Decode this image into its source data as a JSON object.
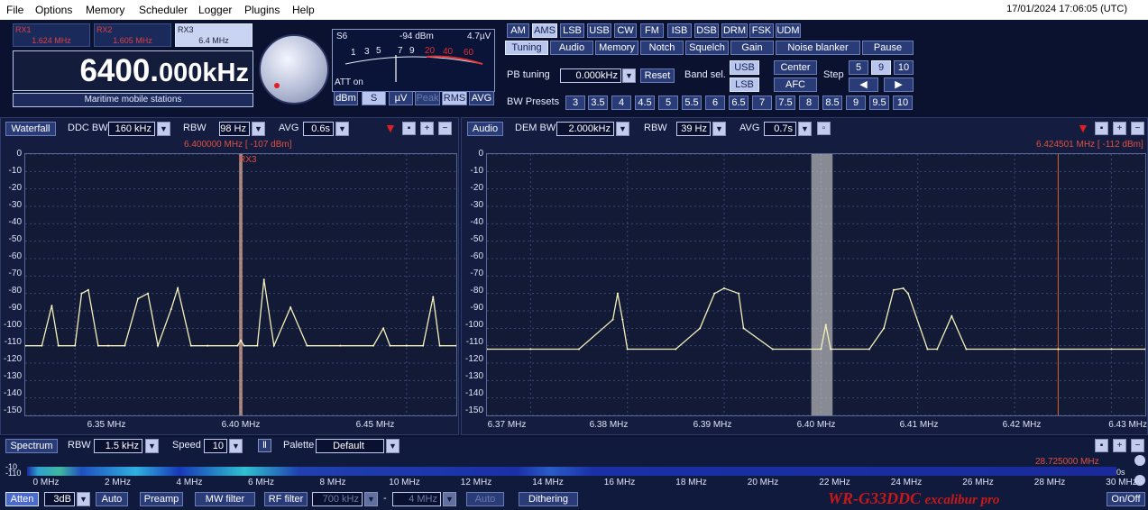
{
  "menu": [
    "File",
    "Options",
    "Memory",
    "Scheduler",
    "Logger",
    "Plugins",
    "Help"
  ],
  "clock": "17/01/2024 17:06:05 (UTC)",
  "receivers": [
    {
      "name": "RX1",
      "freq": "1.624 MHz"
    },
    {
      "name": "RX2",
      "freq": "1.605 MHz"
    },
    {
      "name": "RX3",
      "freq": "6.4 MHz"
    }
  ],
  "frequency_main": "6400.",
  "frequency_fine": "000kHz",
  "band_label": "Maritime mobile stations",
  "smeter": {
    "s_value": "S6",
    "dbm": "-94 dBm",
    "uv": "4.7µV",
    "scale": [
      "1",
      "3",
      "5",
      "7",
      "9",
      "20",
      "40",
      "60"
    ],
    "att": "ATT on"
  },
  "meter_buttons": [
    "dBm",
    "S",
    "µV",
    "Peak",
    "RMS",
    "AVG"
  ],
  "modes": [
    "AM",
    "AMS",
    "LSB",
    "USB",
    "CW",
    "FM",
    "ISB",
    "DSB",
    "DRM",
    "FSK",
    "UDM"
  ],
  "active_mode": "AMS",
  "tabs": [
    "Tuning",
    "Audio",
    "Memory",
    "Notch",
    "Squelch",
    "Gain",
    "Noise blanker",
    "Pause"
  ],
  "tuning": {
    "pb_label": "PB tuning",
    "pb_value": "0.000kHz",
    "reset": "Reset",
    "band_sel_label": "Band sel.",
    "usb": "USB",
    "lsb": "LSB",
    "center": "Center",
    "afc": "AFC",
    "step_label": "Step",
    "steps": [
      "5",
      "9",
      "10"
    ],
    "active_step": "9",
    "bw_label": "BW Presets",
    "bw_presets": [
      "3",
      "3.5",
      "4",
      "4.5",
      "5",
      "5.5",
      "6",
      "6.5",
      "7",
      "7.5",
      "8",
      "8.5",
      "9",
      "9.5",
      "10"
    ]
  },
  "ddc_panel": {
    "mode_button": "Waterfall",
    "bw_label": "DDC BW",
    "bw_value": "160 kHz",
    "rbw_label": "RBW",
    "rbw_value": "98 Hz",
    "avg_label": "AVG",
    "avg_value": "0.6s",
    "marker": "6.400000 MHz [ -107 dBm]",
    "rx_tag": "RX3",
    "x_ticks": [
      "6.35 MHz",
      "6.40 MHz",
      "6.45 MHz"
    ]
  },
  "audio_panel": {
    "mode_button": "Audio",
    "bw_label": "DEM BW",
    "bw_value": "2.000kHz",
    "rbw_label": "RBW",
    "rbw_value": "39 Hz",
    "avg_label": "AVG",
    "avg_value": "0.7s",
    "marker": "6.424501 MHz [ -112 dBm]",
    "x_ticks": [
      "6.37 MHz",
      "6.38 MHz",
      "6.39 MHz",
      "6.40 MHz",
      "6.41 MHz",
      "6.42 MHz",
      "6.43 MHz"
    ]
  },
  "y_ticks": [
    "0",
    "-10",
    "-20",
    "-30",
    "-40",
    "-50",
    "-60",
    "-70",
    "-80",
    "-90",
    "-100",
    "-110",
    "-120",
    "-130",
    "-140",
    "-150"
  ],
  "spectrum_bar": {
    "mode_button": "Spectrum",
    "rbw_label": "RBW",
    "rbw_value": "1.5 kHz",
    "speed_label": "Speed",
    "speed_value": "10",
    "palette_label": "Palette",
    "palette_value": "Default",
    "marker": "28.725000 MHz",
    "y_top": "-10",
    "y_bottom": "-110",
    "time_label": "0s",
    "x_ticks": [
      "0 MHz",
      "2 MHz",
      "4 MHz",
      "6 MHz",
      "8 MHz",
      "10 MHz",
      "12 MHz",
      "14 MHz",
      "16 MHz",
      "18 MHz",
      "20 MHz",
      "22 MHz",
      "24 MHz",
      "26 MHz",
      "28 MHz",
      "30 MHz"
    ]
  },
  "bottom": {
    "atten": "Atten",
    "atten_value": "3dB",
    "auto": "Auto",
    "preamp": "Preamp",
    "mw_filter": "MW filter",
    "rf_filter": "RF filter",
    "rf_low": "700 kHz",
    "dash": "-",
    "rf_high": "4 MHz",
    "auto2": "Auto",
    "dithering": "Dithering",
    "brand": "WR-G33DDC",
    "brand_sub": "excalibur pro",
    "onoff": "On/Off"
  },
  "chart_data": [
    {
      "type": "line",
      "title": "",
      "xlabel": "",
      "ylabel": "dBm",
      "xlim": [
        6.335,
        6.465
      ],
      "ylim": [
        -150,
        0
      ],
      "series": [
        {
          "values_x": [
            6.335,
            6.34,
            6.343,
            6.345,
            6.35,
            6.352,
            6.354,
            6.357,
            6.36,
            6.365,
            6.369,
            6.372,
            6.375,
            6.379,
            6.381,
            6.385,
            6.39,
            6.399,
            6.4,
            6.401,
            6.405,
            6.407,
            6.41,
            6.415,
            6.42,
            6.43,
            6.44,
            6.443,
            6.445,
            6.45,
            6.455,
            6.458,
            6.46,
            6.465
          ],
          "values": [
            -110,
            -110,
            -87,
            -110,
            -110,
            -80,
            -78,
            -110,
            -110,
            -110,
            -83,
            -80,
            -110,
            -89,
            -77,
            -110,
            -110,
            -110,
            -107,
            -110,
            -110,
            -72,
            -110,
            -88,
            -110,
            -110,
            -110,
            -100,
            -110,
            -110,
            -110,
            -82,
            -110,
            -110
          ]
        }
      ]
    },
    {
      "type": "line",
      "title": "",
      "xlabel": "",
      "ylabel": "dBm",
      "xlim": [
        6.3655,
        6.4335
      ],
      "ylim": [
        -150,
        0
      ],
      "series": [
        {
          "values_x": [
            6.3655,
            6.37,
            6.375,
            6.3785,
            6.379,
            6.3795,
            6.38,
            6.385,
            6.3875,
            6.389,
            6.39,
            6.3915,
            6.392,
            6.395,
            6.4,
            6.4005,
            6.401,
            6.405,
            6.4065,
            6.4075,
            6.4085,
            6.409,
            6.411,
            6.412,
            6.4135,
            6.415,
            6.42,
            6.4245,
            6.43,
            6.4335
          ],
          "values": [
            -112,
            -112,
            -112,
            -95,
            -80,
            -95,
            -112,
            -112,
            -100,
            -80,
            -77,
            -80,
            -100,
            -112,
            -112,
            -98,
            -112,
            -112,
            -100,
            -78,
            -77,
            -80,
            -112,
            -112,
            -93,
            -112,
            -112,
            -112,
            -112,
            -112
          ]
        }
      ]
    }
  ]
}
